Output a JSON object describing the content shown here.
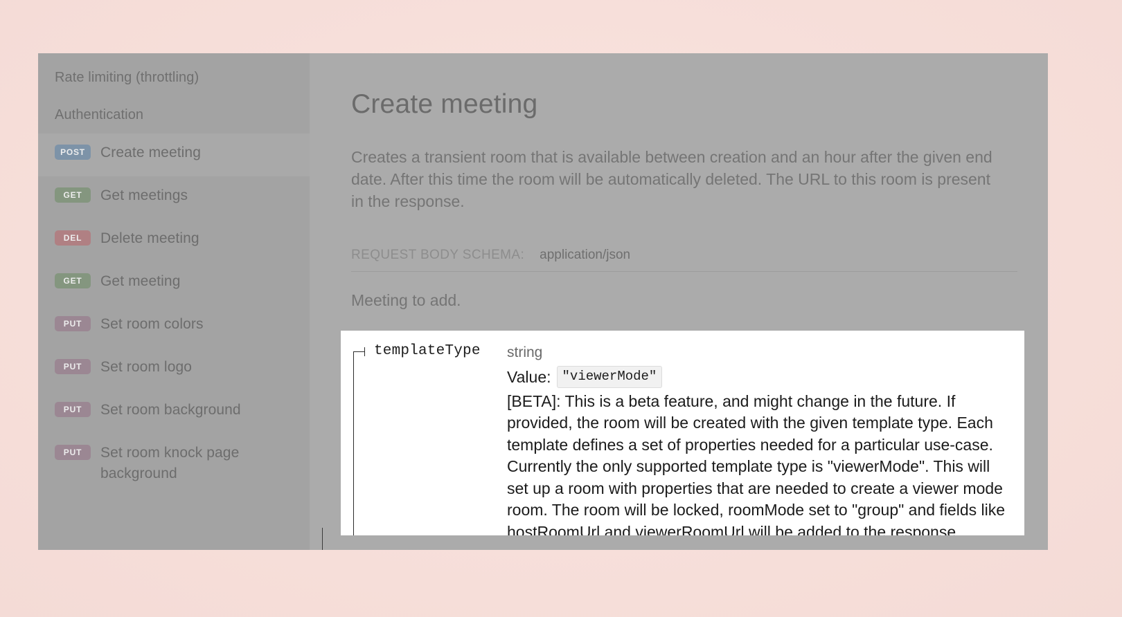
{
  "colors": {
    "backdrop": "#f8e1dc",
    "dim_overlay_sidebar": "#a3a3a3",
    "dim_overlay_content": "#ababab",
    "highlight_panel": "#ffffff",
    "badge_post": "#7d93a8",
    "badge_get": "#84967f",
    "badge_del": "#b08083",
    "badge_put": "#9b8793"
  },
  "sidebar": {
    "sections": [
      {
        "label": "Rate limiting (throttling)"
      },
      {
        "label": "Authentication"
      }
    ],
    "items": [
      {
        "method": "POST",
        "label": "Create meeting",
        "active": true
      },
      {
        "method": "GET",
        "label": "Get meetings",
        "active": false
      },
      {
        "method": "DEL",
        "label": "Delete meeting",
        "active": false
      },
      {
        "method": "GET",
        "label": "Get meeting",
        "active": false
      },
      {
        "method": "PUT",
        "label": "Set room colors",
        "active": false
      },
      {
        "method": "PUT",
        "label": "Set room logo",
        "active": false
      },
      {
        "method": "PUT",
        "label": "Set room background",
        "active": false
      },
      {
        "method": "PUT",
        "label": "Set room knock page background",
        "active": false
      }
    ]
  },
  "main": {
    "title": "Create meeting",
    "description": "Creates a transient room that is available between creation and an hour after the given end date. After this time the room will be automatically deleted. The URL to this room is present in the response.",
    "schema_label": "REQUEST BODY SCHEMA:",
    "schema_value": "application/json",
    "schema_note": "Meeting to add."
  },
  "property_panel": {
    "name": "templateType",
    "type": "string",
    "value_label": "Value:",
    "value": "\"viewerMode\"",
    "description": "[BETA]: This is a beta feature, and might change in the future. If provided, the room will be created with the given template type. Each template defines a set of properties needed for a particular use-case. Currently the only supported template type is \"viewerMode\". This will set up a room with properties that are needed to create a viewer mode room. The room will be locked, roomMode set to \"group\" and fields like hostRoomUrl and viewerRoomUrl will be added to the response."
  }
}
